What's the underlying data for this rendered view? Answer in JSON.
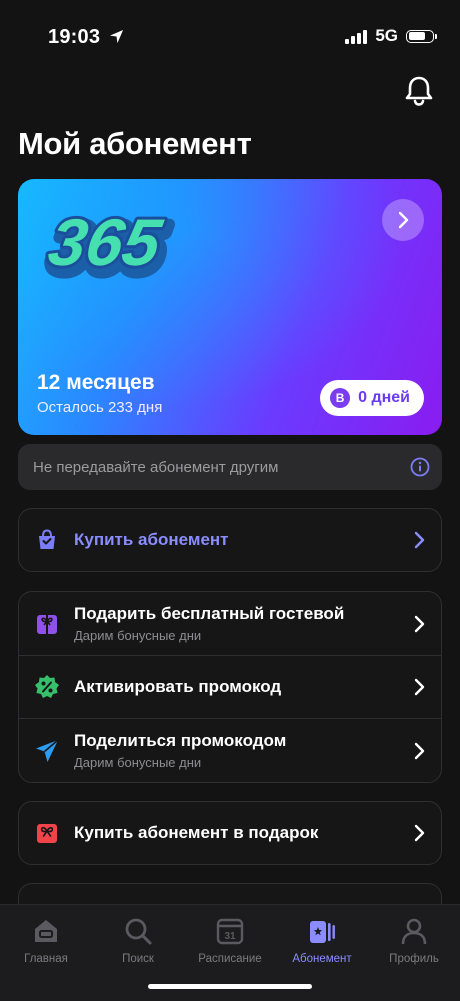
{
  "status_bar": {
    "time": "19:03",
    "network": "5G"
  },
  "header": {
    "title": "Мой абонемент"
  },
  "card": {
    "logo_text": "365",
    "months": "12 месяцев",
    "remaining": "Осталось 233 дня",
    "badge_letter": "B",
    "days_balance": "0 дней"
  },
  "notice": {
    "text": "Не передавайте абонемент другим"
  },
  "buy": {
    "label": "Купить абонемент"
  },
  "actions": [
    {
      "label": "Подарить бесплатный гостевой",
      "sub": "Дарим бонусные дни"
    },
    {
      "label": "Активировать промокод"
    },
    {
      "label": "Поделиться промокодом",
      "sub": "Дарим бонусные дни"
    }
  ],
  "gift": {
    "label": "Купить абонемент в подарок"
  },
  "tabbar": [
    {
      "label": "Главная"
    },
    {
      "label": "Поиск"
    },
    {
      "label": "Расписание",
      "icon_text": "31"
    },
    {
      "label": "Абонемент",
      "active": true
    },
    {
      "label": "Профиль"
    }
  ],
  "colors": {
    "accent": "#8a8cff",
    "background": "#131313",
    "card_start": "#17b9ff",
    "card_end": "#8a1cf0"
  }
}
